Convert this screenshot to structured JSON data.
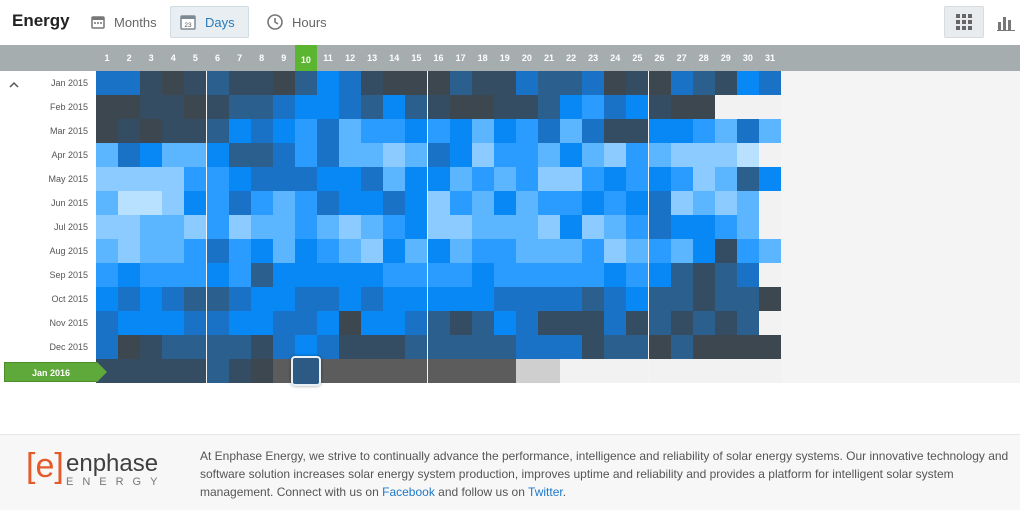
{
  "header": {
    "title": "Energy",
    "months_label": "Months",
    "days_label": "Days",
    "hours_label": "Hours",
    "calendar_day_number": "23"
  },
  "days": [
    "1",
    "2",
    "3",
    "4",
    "5",
    "6",
    "7",
    "8",
    "9",
    "10",
    "11",
    "12",
    "13",
    "14",
    "15",
    "16",
    "17",
    "18",
    "19",
    "20",
    "21",
    "22",
    "23",
    "24",
    "25",
    "26",
    "27",
    "28",
    "29",
    "30",
    "31"
  ],
  "selected_day": "10",
  "months": [
    "Jan 2015",
    "Feb 2015",
    "Mar 2015",
    "Apr 2015",
    "May 2015",
    "Jun 2015",
    "Jul 2015",
    "Aug 2015",
    "Sep 2015",
    "Oct 2015",
    "Nov 2015",
    "Dec 2015"
  ],
  "selected_month": "Jan 2016",
  "heatmap_colors": [
    "#3d4750",
    "#344d63",
    "#2b5f8e",
    "#1a72c6",
    "#0788f5",
    "#2b9cff",
    "#5bb5ff",
    "#8ccbff",
    "#b8e0ff",
    "#5c5c5c",
    "#cfcfcf",
    "#f2f2f2"
  ],
  "heatmap_rows": [
    [
      3,
      3,
      1,
      0,
      1,
      2,
      1,
      1,
      0,
      2,
      4,
      3,
      1,
      0,
      0,
      0,
      2,
      1,
      1,
      3,
      2,
      2,
      3,
      0,
      1,
      0,
      3,
      2,
      1,
      4,
      3
    ],
    [
      0,
      0,
      1,
      1,
      0,
      1,
      2,
      2,
      3,
      4,
      4,
      3,
      2,
      4,
      2,
      1,
      0,
      0,
      1,
      1,
      2,
      4,
      5,
      3,
      4,
      1,
      0,
      0,
      11,
      11,
      11
    ],
    [
      0,
      1,
      0,
      1,
      1,
      2,
      4,
      3,
      4,
      5,
      3,
      6,
      5,
      5,
      4,
      5,
      4,
      6,
      4,
      5,
      3,
      6,
      3,
      1,
      1,
      4,
      4,
      5,
      6,
      3,
      6
    ],
    [
      6,
      3,
      4,
      6,
      6,
      4,
      2,
      2,
      3,
      5,
      3,
      6,
      6,
      7,
      6,
      3,
      4,
      7,
      5,
      5,
      6,
      4,
      6,
      7,
      5,
      6,
      7,
      7,
      7,
      8,
      11
    ],
    [
      7,
      7,
      7,
      7,
      5,
      5,
      4,
      3,
      3,
      3,
      4,
      4,
      3,
      6,
      4,
      4,
      6,
      5,
      6,
      5,
      7,
      7,
      5,
      4,
      5,
      4,
      5,
      7,
      6,
      2,
      4
    ],
    [
      6,
      8,
      8,
      7,
      4,
      5,
      3,
      5,
      6,
      5,
      3,
      4,
      4,
      3,
      4,
      7,
      5,
      6,
      4,
      6,
      5,
      5,
      4,
      5,
      4,
      3,
      7,
      6,
      7,
      6,
      11
    ],
    [
      7,
      7,
      6,
      6,
      7,
      5,
      7,
      6,
      6,
      5,
      6,
      7,
      6,
      5,
      4,
      7,
      7,
      6,
      6,
      6,
      7,
      4,
      7,
      6,
      5,
      3,
      4,
      4,
      5,
      6,
      11
    ],
    [
      6,
      7,
      6,
      6,
      5,
      3,
      5,
      4,
      6,
      4,
      5,
      6,
      7,
      4,
      6,
      4,
      6,
      5,
      5,
      6,
      6,
      6,
      5,
      7,
      6,
      5,
      6,
      4,
      1,
      5,
      6
    ],
    [
      5,
      4,
      5,
      5,
      5,
      4,
      5,
      2,
      4,
      4,
      4,
      4,
      4,
      5,
      5,
      5,
      5,
      4,
      5,
      5,
      5,
      5,
      5,
      4,
      5,
      4,
      2,
      1,
      2,
      3,
      11
    ],
    [
      4,
      3,
      4,
      3,
      2,
      2,
      3,
      4,
      4,
      3,
      3,
      4,
      3,
      4,
      4,
      4,
      4,
      4,
      3,
      3,
      3,
      3,
      2,
      3,
      4,
      2,
      2,
      1,
      2,
      2,
      0
    ],
    [
      3,
      4,
      4,
      4,
      3,
      3,
      4,
      4,
      3,
      3,
      4,
      0,
      4,
      4,
      3,
      2,
      1,
      2,
      4,
      3,
      1,
      1,
      1,
      3,
      1,
      2,
      1,
      2,
      1,
      2,
      11
    ],
    [
      3,
      0,
      1,
      2,
      2,
      2,
      2,
      1,
      3,
      4,
      3,
      1,
      1,
      1,
      2,
      2,
      2,
      2,
      2,
      3,
      3,
      3,
      1,
      2,
      2,
      0,
      2,
      0,
      0,
      0,
      0
    ]
  ],
  "jan2016_row": [
    1,
    1,
    1,
    1,
    1,
    2,
    1,
    0,
    9,
    9,
    9,
    9,
    9,
    9,
    9,
    9,
    9,
    9,
    9,
    10,
    10,
    11,
    11,
    11,
    11,
    11,
    11,
    11,
    11,
    11,
    11
  ],
  "footer": {
    "logo_bracket_left": "[",
    "logo_letter": "e",
    "logo_bracket_right": "]",
    "logo_word": "enphase",
    "logo_subtitle": "ENERGY",
    "text": "At Enphase Energy, we strive to continually advance the performance, intelligence and reliability of solar energy systems. Our innovative technology and software solution increases solar energy system production, improves uptime and reliability and provides a platform for intelligent solar system management. Connect with us on",
    "link_facebook": "Facebook",
    "text2": "and follow us on",
    "link_twitter": "Twitter",
    "period": "."
  }
}
